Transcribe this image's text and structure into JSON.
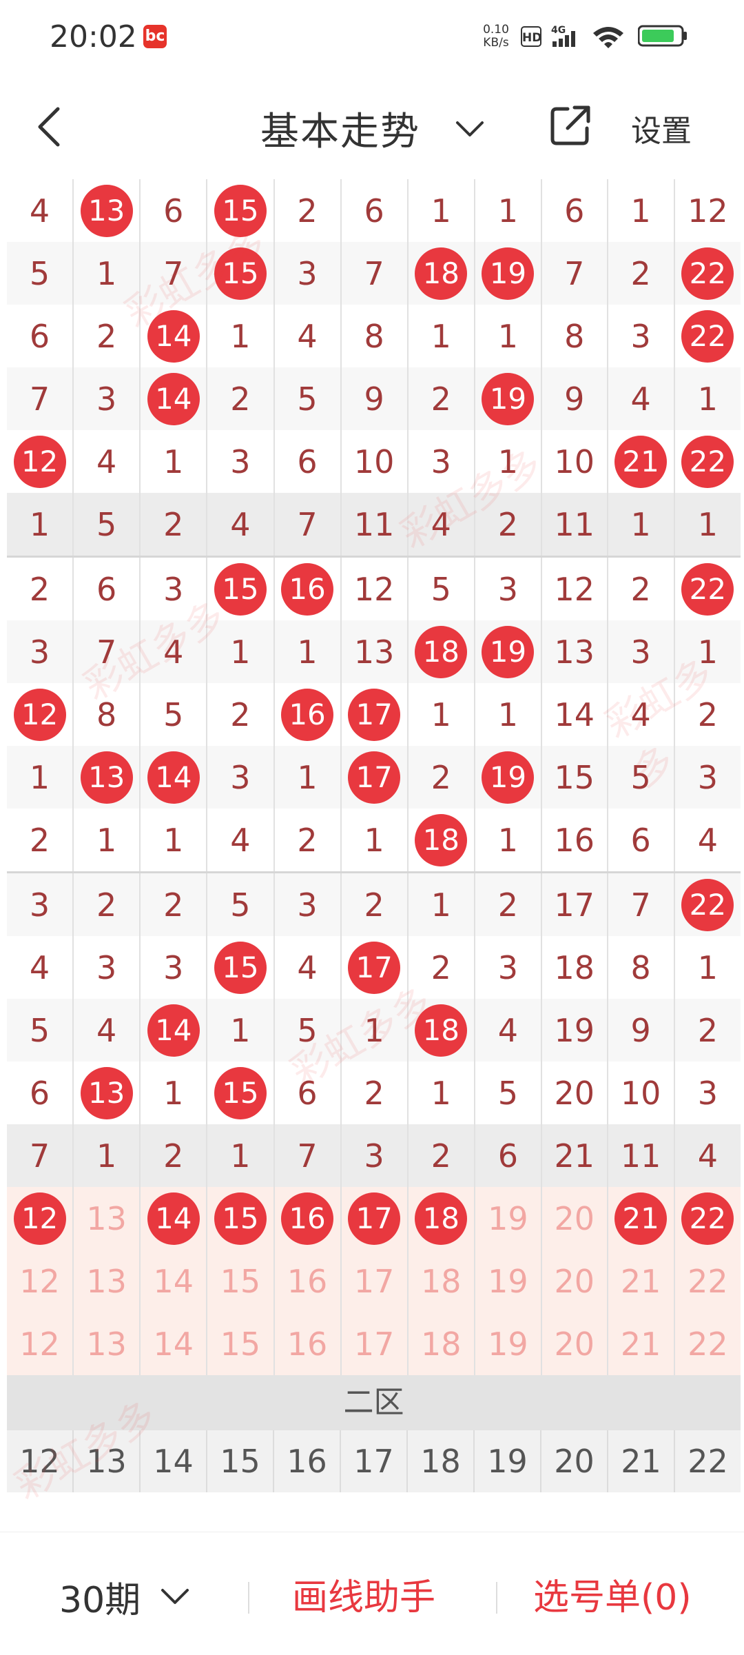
{
  "status_bar": {
    "time": "20:02",
    "app_icon": "bc",
    "net_speed_value": "0.10",
    "net_speed_unit": "KB/s",
    "hd": "HD",
    "network": "4G"
  },
  "nav": {
    "title": "基本走势",
    "settings": "设置"
  },
  "grid": {
    "rows": [
      [
        {
          "v": "4"
        },
        {
          "v": "13",
          "hit": true
        },
        {
          "v": "6"
        },
        {
          "v": "15",
          "hit": true
        },
        {
          "v": "2"
        },
        {
          "v": "6"
        },
        {
          "v": "1"
        },
        {
          "v": "1"
        },
        {
          "v": "6"
        },
        {
          "v": "1"
        },
        {
          "v": "12"
        }
      ],
      [
        {
          "v": "5"
        },
        {
          "v": "1"
        },
        {
          "v": "7"
        },
        {
          "v": "15",
          "hit": true
        },
        {
          "v": "3"
        },
        {
          "v": "7"
        },
        {
          "v": "18",
          "hit": true
        },
        {
          "v": "19",
          "hit": true
        },
        {
          "v": "7"
        },
        {
          "v": "2"
        },
        {
          "v": "22",
          "hit": true
        }
      ],
      [
        {
          "v": "6"
        },
        {
          "v": "2"
        },
        {
          "v": "14",
          "hit": true
        },
        {
          "v": "1"
        },
        {
          "v": "4"
        },
        {
          "v": "8"
        },
        {
          "v": "1"
        },
        {
          "v": "1"
        },
        {
          "v": "8"
        },
        {
          "v": "3"
        },
        {
          "v": "22",
          "hit": true
        }
      ],
      [
        {
          "v": "7"
        },
        {
          "v": "3"
        },
        {
          "v": "14",
          "hit": true
        },
        {
          "v": "2"
        },
        {
          "v": "5"
        },
        {
          "v": "9"
        },
        {
          "v": "2"
        },
        {
          "v": "19",
          "hit": true
        },
        {
          "v": "9"
        },
        {
          "v": "4"
        },
        {
          "v": "1"
        }
      ],
      [
        {
          "v": "12",
          "hit": true
        },
        {
          "v": "4"
        },
        {
          "v": "1"
        },
        {
          "v": "3"
        },
        {
          "v": "6"
        },
        {
          "v": "10"
        },
        {
          "v": "3"
        },
        {
          "v": "1"
        },
        {
          "v": "10"
        },
        {
          "v": "21",
          "hit": true
        },
        {
          "v": "22",
          "hit": true
        }
      ],
      [
        {
          "v": "1"
        },
        {
          "v": "5"
        },
        {
          "v": "2"
        },
        {
          "v": "4"
        },
        {
          "v": "7"
        },
        {
          "v": "11"
        },
        {
          "v": "4"
        },
        {
          "v": "2"
        },
        {
          "v": "11"
        },
        {
          "v": "1"
        },
        {
          "v": "1"
        }
      ],
      [
        {
          "v": "2"
        },
        {
          "v": "6"
        },
        {
          "v": "3"
        },
        {
          "v": "15",
          "hit": true
        },
        {
          "v": "16",
          "hit": true
        },
        {
          "v": "12"
        },
        {
          "v": "5"
        },
        {
          "v": "3"
        },
        {
          "v": "12"
        },
        {
          "v": "2"
        },
        {
          "v": "22",
          "hit": true
        }
      ],
      [
        {
          "v": "3"
        },
        {
          "v": "7"
        },
        {
          "v": "4"
        },
        {
          "v": "1"
        },
        {
          "v": "1"
        },
        {
          "v": "13"
        },
        {
          "v": "18",
          "hit": true
        },
        {
          "v": "19",
          "hit": true
        },
        {
          "v": "13"
        },
        {
          "v": "3"
        },
        {
          "v": "1"
        }
      ],
      [
        {
          "v": "12",
          "hit": true
        },
        {
          "v": "8"
        },
        {
          "v": "5"
        },
        {
          "v": "2"
        },
        {
          "v": "16",
          "hit": true
        },
        {
          "v": "17",
          "hit": true
        },
        {
          "v": "1"
        },
        {
          "v": "1"
        },
        {
          "v": "14"
        },
        {
          "v": "4"
        },
        {
          "v": "2"
        }
      ],
      [
        {
          "v": "1"
        },
        {
          "v": "13",
          "hit": true
        },
        {
          "v": "14",
          "hit": true
        },
        {
          "v": "3"
        },
        {
          "v": "1"
        },
        {
          "v": "17",
          "hit": true
        },
        {
          "v": "2"
        },
        {
          "v": "19",
          "hit": true
        },
        {
          "v": "15"
        },
        {
          "v": "5"
        },
        {
          "v": "3"
        }
      ],
      [
        {
          "v": "2"
        },
        {
          "v": "1"
        },
        {
          "v": "1"
        },
        {
          "v": "4"
        },
        {
          "v": "2"
        },
        {
          "v": "1"
        },
        {
          "v": "18",
          "hit": true
        },
        {
          "v": "1"
        },
        {
          "v": "16"
        },
        {
          "v": "6"
        },
        {
          "v": "4"
        }
      ],
      [
        {
          "v": "3"
        },
        {
          "v": "2"
        },
        {
          "v": "2"
        },
        {
          "v": "5"
        },
        {
          "v": "3"
        },
        {
          "v": "2"
        },
        {
          "v": "1"
        },
        {
          "v": "2"
        },
        {
          "v": "17"
        },
        {
          "v": "7"
        },
        {
          "v": "22",
          "hit": true
        }
      ],
      [
        {
          "v": "4"
        },
        {
          "v": "3"
        },
        {
          "v": "3"
        },
        {
          "v": "15",
          "hit": true
        },
        {
          "v": "4"
        },
        {
          "v": "17",
          "hit": true
        },
        {
          "v": "2"
        },
        {
          "v": "3"
        },
        {
          "v": "18"
        },
        {
          "v": "8"
        },
        {
          "v": "1"
        }
      ],
      [
        {
          "v": "5"
        },
        {
          "v": "4"
        },
        {
          "v": "14",
          "hit": true
        },
        {
          "v": "1"
        },
        {
          "v": "5"
        },
        {
          "v": "1"
        },
        {
          "v": "18",
          "hit": true
        },
        {
          "v": "4"
        },
        {
          "v": "19"
        },
        {
          "v": "9"
        },
        {
          "v": "2"
        }
      ],
      [
        {
          "v": "6"
        },
        {
          "v": "13",
          "hit": true
        },
        {
          "v": "1"
        },
        {
          "v": "15",
          "hit": true
        },
        {
          "v": "6"
        },
        {
          "v": "2"
        },
        {
          "v": "1"
        },
        {
          "v": "5"
        },
        {
          "v": "20"
        },
        {
          "v": "10"
        },
        {
          "v": "3"
        }
      ],
      [
        {
          "v": "7"
        },
        {
          "v": "1"
        },
        {
          "v": "2"
        },
        {
          "v": "1"
        },
        {
          "v": "7"
        },
        {
          "v": "3"
        },
        {
          "v": "2"
        },
        {
          "v": "6"
        },
        {
          "v": "21"
        },
        {
          "v": "11"
        },
        {
          "v": "4"
        }
      ],
      [
        {
          "v": "12",
          "hit": true
        },
        {
          "v": "13"
        },
        {
          "v": "14",
          "hit": true
        },
        {
          "v": "15",
          "hit": true
        },
        {
          "v": "16",
          "hit": true
        },
        {
          "v": "17",
          "hit": true
        },
        {
          "v": "18",
          "hit": true
        },
        {
          "v": "19"
        },
        {
          "v": "20"
        },
        {
          "v": "21",
          "hit": true
        },
        {
          "v": "22",
          "hit": true
        }
      ],
      [
        {
          "v": "12"
        },
        {
          "v": "13"
        },
        {
          "v": "14"
        },
        {
          "v": "15"
        },
        {
          "v": "16"
        },
        {
          "v": "17"
        },
        {
          "v": "18"
        },
        {
          "v": "19"
        },
        {
          "v": "20"
        },
        {
          "v": "21"
        },
        {
          "v": "22"
        }
      ],
      [
        {
          "v": "12"
        },
        {
          "v": "13"
        },
        {
          "v": "14"
        },
        {
          "v": "15"
        },
        {
          "v": "16"
        },
        {
          "v": "17"
        },
        {
          "v": "18"
        },
        {
          "v": "19"
        },
        {
          "v": "20"
        },
        {
          "v": "21"
        },
        {
          "v": "22"
        }
      ]
    ],
    "zone_label": "二区",
    "zone_numbers": [
      "12",
      "13",
      "14",
      "15",
      "16",
      "17",
      "18",
      "19",
      "20",
      "21",
      "22"
    ]
  },
  "bottom_bar": {
    "period": "30期",
    "draw_helper": "画线助手",
    "picked_list": "选号单(0)"
  },
  "colors": {
    "accent": "#e8383f",
    "grid_text": "#a03a3a",
    "stat_bg": "#fdeee9"
  }
}
